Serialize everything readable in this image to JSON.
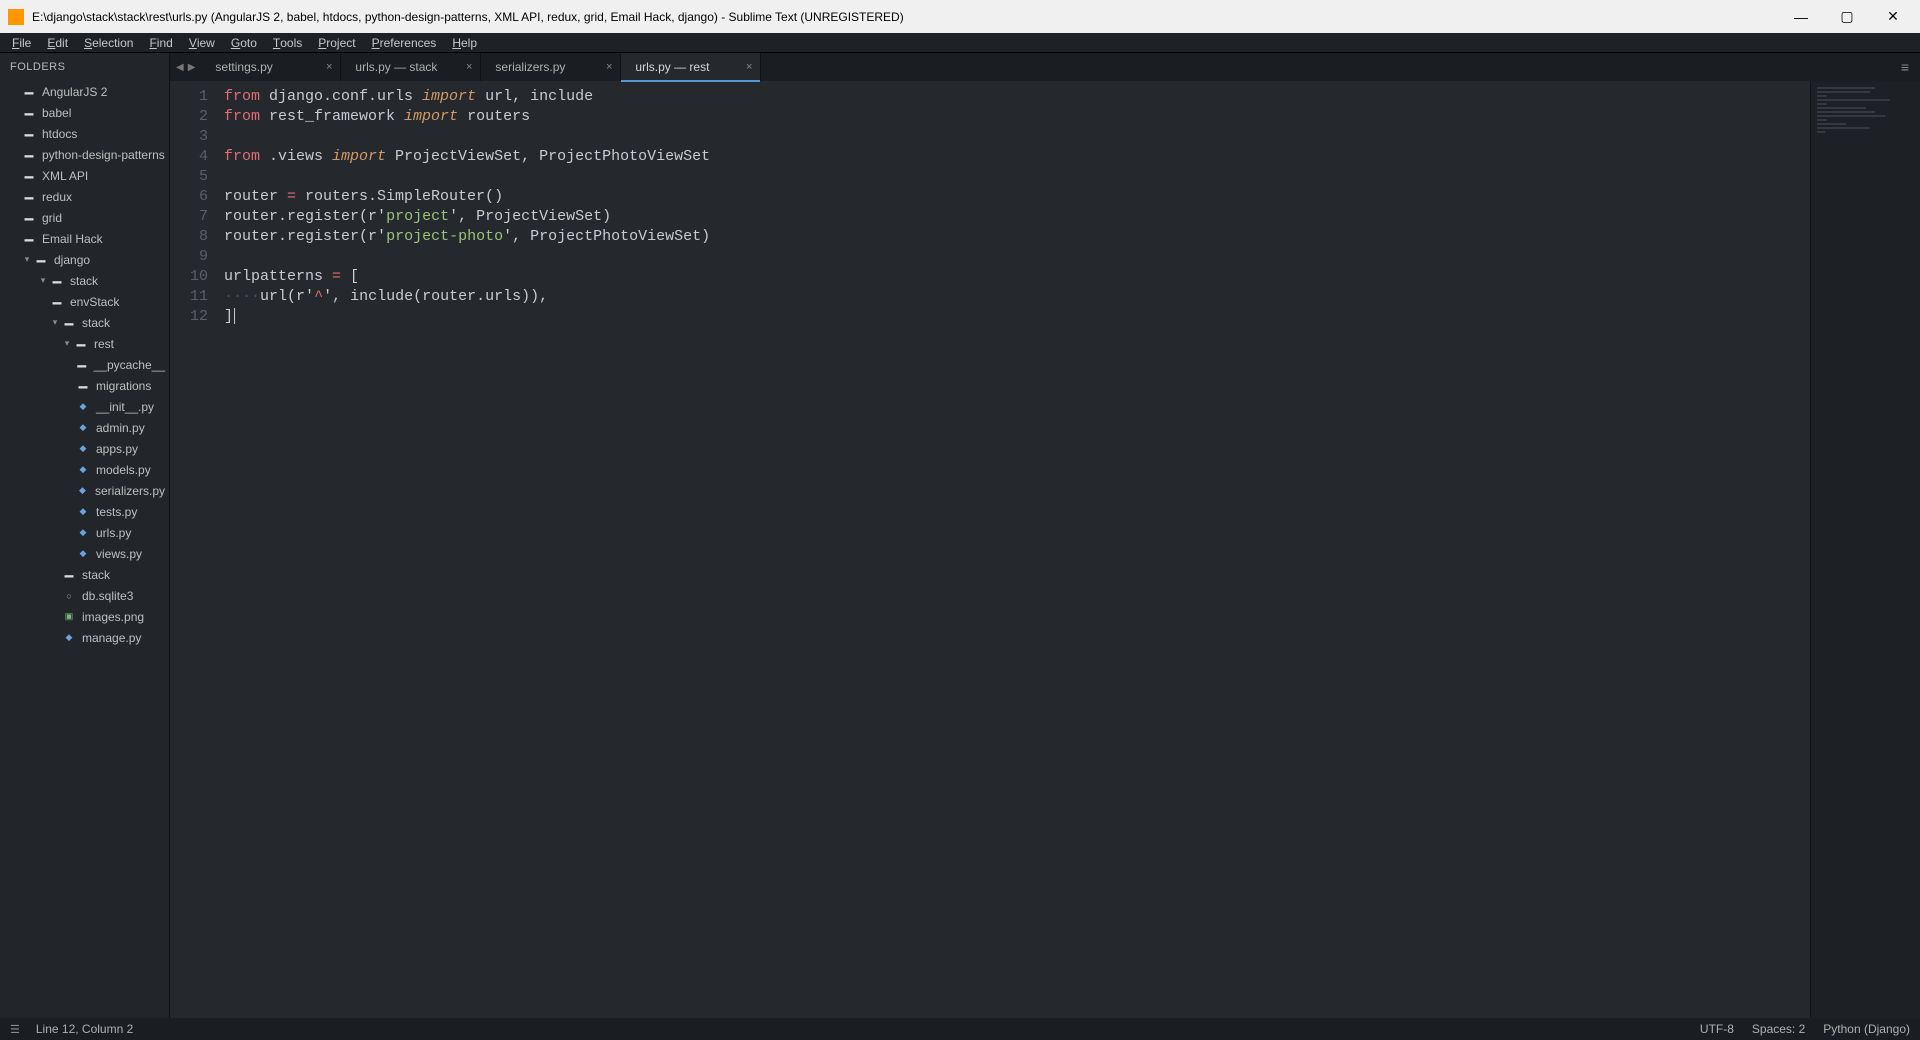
{
  "titlebar": {
    "text": "E:\\django\\stack\\stack\\rest\\urls.py (AngularJS 2, babel, htdocs, python-design-patterns, XML API, redux, grid, Email Hack, django) - Sublime Text (UNREGISTERED)"
  },
  "menu": {
    "items": [
      "File",
      "Edit",
      "Selection",
      "Find",
      "View",
      "Goto",
      "Tools",
      "Project",
      "Preferences",
      "Help"
    ]
  },
  "sidebar": {
    "header": "FOLDERS",
    "tree": [
      {
        "depth": 1,
        "icon": "folder",
        "label": "AngularJS 2"
      },
      {
        "depth": 1,
        "icon": "folder",
        "label": "babel"
      },
      {
        "depth": 1,
        "icon": "folder",
        "label": "htdocs"
      },
      {
        "depth": 1,
        "icon": "folder",
        "label": "python-design-patterns"
      },
      {
        "depth": 1,
        "icon": "folder",
        "label": "XML API"
      },
      {
        "depth": 1,
        "icon": "folder",
        "label": "redux"
      },
      {
        "depth": 1,
        "icon": "folder",
        "label": "grid"
      },
      {
        "depth": 1,
        "icon": "folder",
        "label": "Email Hack"
      },
      {
        "depth": 1,
        "icon": "chev-down",
        "label": "django"
      },
      {
        "depth": 2,
        "icon": "chev-down",
        "label": "stack"
      },
      {
        "depth": 3,
        "icon": "folder",
        "label": "envStack"
      },
      {
        "depth": 3,
        "icon": "chev-down",
        "label": "stack"
      },
      {
        "depth": 4,
        "icon": "chev-down",
        "label": "rest"
      },
      {
        "depth": 5,
        "icon": "folder",
        "label": "__pycache__"
      },
      {
        "depth": 5,
        "icon": "folder",
        "label": "migrations"
      },
      {
        "depth": 5,
        "icon": "py",
        "label": "__init__.py"
      },
      {
        "depth": 5,
        "icon": "py",
        "label": "admin.py"
      },
      {
        "depth": 5,
        "icon": "py",
        "label": "apps.py"
      },
      {
        "depth": 5,
        "icon": "py",
        "label": "models.py"
      },
      {
        "depth": 5,
        "icon": "py",
        "label": "serializers.py"
      },
      {
        "depth": 5,
        "icon": "py",
        "label": "tests.py"
      },
      {
        "depth": 5,
        "icon": "py",
        "label": "urls.py"
      },
      {
        "depth": 5,
        "icon": "py",
        "label": "views.py"
      },
      {
        "depth": 4,
        "icon": "folder",
        "label": "stack"
      },
      {
        "depth": 4,
        "icon": "db",
        "label": "db.sqlite3"
      },
      {
        "depth": 4,
        "icon": "img",
        "label": "images.png"
      },
      {
        "depth": 4,
        "icon": "py",
        "label": "manage.py"
      }
    ]
  },
  "tabs": [
    {
      "label": "settings.py",
      "active": false
    },
    {
      "label": "urls.py — stack",
      "active": false
    },
    {
      "label": "serializers.py",
      "active": false
    },
    {
      "label": "urls.py — rest",
      "active": true
    }
  ],
  "code": {
    "lines": [
      [
        {
          "t": "from",
          "c": "kw-red"
        },
        {
          "t": " django.conf.urls ",
          "c": "ident"
        },
        {
          "t": "import",
          "c": "kw-orange"
        },
        {
          "t": " url, include",
          "c": "ident"
        }
      ],
      [
        {
          "t": "from",
          "c": "kw-red"
        },
        {
          "t": " rest_framework ",
          "c": "ident"
        },
        {
          "t": "import",
          "c": "kw-orange"
        },
        {
          "t": " routers",
          "c": "ident"
        }
      ],
      [],
      [
        {
          "t": "from",
          "c": "kw-red"
        },
        {
          "t": " .views ",
          "c": "ident"
        },
        {
          "t": "import",
          "c": "kw-orange"
        },
        {
          "t": " ProjectViewSet, ProjectPhotoViewSet",
          "c": "ident"
        }
      ],
      [],
      [
        {
          "t": "router ",
          "c": "ident"
        },
        {
          "t": "=",
          "c": "kw-red"
        },
        {
          "t": " routers.SimpleRouter()",
          "c": "ident"
        }
      ],
      [
        {
          "t": "router.register(",
          "c": "ident"
        },
        {
          "t": "r",
          "c": "ident"
        },
        {
          "t": "'",
          "c": "punct"
        },
        {
          "t": "project",
          "c": "str-green"
        },
        {
          "t": "'",
          "c": "punct"
        },
        {
          "t": ", ProjectViewSet)",
          "c": "ident"
        }
      ],
      [
        {
          "t": "router.register(",
          "c": "ident"
        },
        {
          "t": "r",
          "c": "ident"
        },
        {
          "t": "'",
          "c": "punct"
        },
        {
          "t": "project-photo",
          "c": "str-green"
        },
        {
          "t": "'",
          "c": "punct"
        },
        {
          "t": ", ProjectPhotoViewSet)",
          "c": "ident"
        }
      ],
      [],
      [
        {
          "t": "urlpatterns ",
          "c": "ident"
        },
        {
          "t": "=",
          "c": "kw-red"
        },
        {
          "t": " [",
          "c": "ident"
        }
      ],
      [
        {
          "t": "····",
          "c": "dots"
        },
        {
          "t": "url(",
          "c": "ident"
        },
        {
          "t": "r",
          "c": "ident"
        },
        {
          "t": "'",
          "c": "punct"
        },
        {
          "t": "^",
          "c": "str-red"
        },
        {
          "t": "'",
          "c": "punct"
        },
        {
          "t": ", include(router.urls)),",
          "c": "ident"
        }
      ],
      [
        {
          "t": "]",
          "c": "ident"
        }
      ]
    ]
  },
  "status": {
    "cursor": "Line 12, Column 2",
    "encoding": "UTF-8",
    "spaces": "Spaces: 2",
    "syntax": "Python (Django)"
  }
}
